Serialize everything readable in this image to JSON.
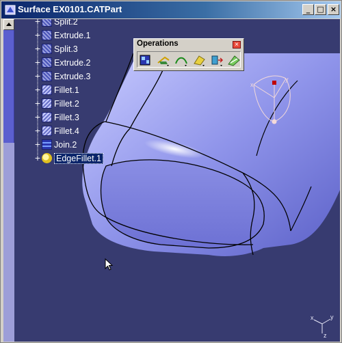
{
  "window": {
    "title": "Surface EX0101.CATPart",
    "buttons": [
      "_",
      "□",
      "×"
    ]
  },
  "tree": {
    "items": [
      {
        "label": "Split.2",
        "icon": "split-icon"
      },
      {
        "label": "Extrude.1",
        "icon": "extrude-icon"
      },
      {
        "label": "Split.3",
        "icon": "split-icon"
      },
      {
        "label": "Extrude.2",
        "icon": "extrude-icon"
      },
      {
        "label": "Extrude.3",
        "icon": "extrude-icon"
      },
      {
        "label": "Fillet.1",
        "icon": "fillet-icon"
      },
      {
        "label": "Fillet.2",
        "icon": "fillet-icon"
      },
      {
        "label": "Fillet.3",
        "icon": "fillet-icon"
      },
      {
        "label": "Fillet.4",
        "icon": "fillet-icon"
      },
      {
        "label": "Join.2",
        "icon": "join-icon"
      },
      {
        "label": "EdgeFillet.1",
        "icon": "edge-fillet-icon",
        "selected": true
      }
    ]
  },
  "toolbar": {
    "title": "Operations",
    "close": "×",
    "tools": [
      "join-icon",
      "trim-icon",
      "split-icon",
      "fillet-icon",
      "translate-icon",
      "extrapolate-icon"
    ]
  },
  "axes": {
    "x": "x",
    "y": "y",
    "z": "z"
  },
  "colors": {
    "background": "#373b70",
    "part": "#9ea2f0",
    "titlebar": "#0a246a"
  }
}
